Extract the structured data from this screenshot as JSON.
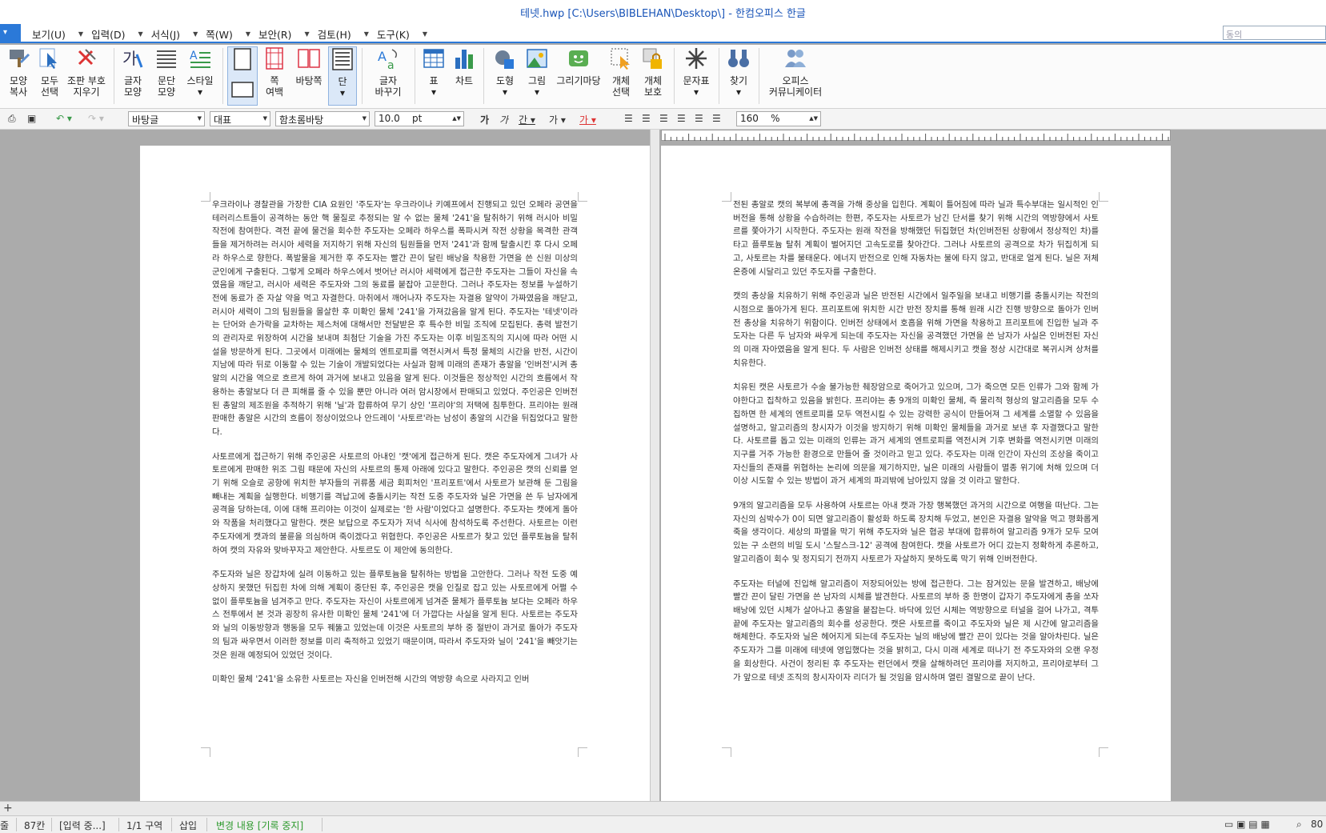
{
  "window": {
    "title": "테넷.hwp [C:\\Users\\BIBLEHAN\\Desktop\\] - 한컴오피스 한글"
  },
  "menu": {
    "items": [
      "보기(U)",
      "입력(D)",
      "서식(J)",
      "쪽(W)",
      "보안(R)",
      "검토(H)",
      "도구(K)"
    ],
    "search_placeholder": "동의"
  },
  "ribbon": {
    "shape_copy": [
      "모양",
      "복사"
    ],
    "select_all": [
      "모두",
      "선택"
    ],
    "clear_format": [
      "조판 부호",
      "지우기"
    ],
    "char_shape": [
      "글자",
      "모양"
    ],
    "para_shape": [
      "문단",
      "모양"
    ],
    "style": "스타일",
    "page_margin": [
      "쪽",
      "여백"
    ],
    "background_page": "바탕쪽",
    "columns": "단",
    "replace_chars": [
      "글자",
      "바꾸기"
    ],
    "table": "표",
    "chart": "차트",
    "shape": "도형",
    "picture": "그림",
    "drawing_market": "그리기마당",
    "object_select": [
      "개체",
      "선택"
    ],
    "object_protect": [
      "개체",
      "보호"
    ],
    "symbols": "문자표",
    "find": "찾기",
    "office_comm": [
      "오피스",
      "커뮤니케이터"
    ]
  },
  "format": {
    "style_combo": "바탕글",
    "lang_combo": "대표",
    "font_combo": "함초롬바탕",
    "size_value": "10.0",
    "size_unit": "pt",
    "zoom_value": "160",
    "zoom_unit": "%"
  },
  "left_page": {
    "paragraphs": [
      "우크라이나 경찰관을 가장한 CIA 요원인 '주도자'는 우크라이나 키예프에서 진행되고 있던 오페라 공연을 테러리스트들이 공격하는 동안 핵 물질로 추정되는 알 수 없는 물체 '241'을 탈취하기 위해 러시아 비밀 작전에 참여한다. 격전 끝에 물건을 회수한 주도자는 오페라 하우스를 폭파시켜 작전 상황을 목격한 관객들을 제거하려는 러시아 세력을 저지하기 위해 자신의 팀원들을 먼저 '241'과 함께 탈출시킨 후 다시 오페라 하우스로 향한다. 폭발물을 제거한 후 주도자는 빨간 끈이 달린 배낭을 착용한 가면을 쓴 신원 미상의 군인에게 구출된다. 그렇게 오페라 하우스에서 벗어난 러시아 세력에게 접근한 주도자는 그들이 자신을 속였음을 깨닫고, 러시아 세력은 주도자와 그의 동료를 붙잡아 고문한다. 그러나 주도자는 정보를 누설하기 전에 동료가 준 자살 약을 먹고 자결한다. 마취에서 깨어나자 주도자는 자결용 알약이 가짜였음을 깨닫고, 러시아 세력이 그의 팀원들을 몰살한 후 미확인 물체 '241'을 가져갔음을 알게 된다. 주도자는 '테넷'이라는 단어와 손가락을 교차하는 제스처에 대해서만 전달받은 후 특수한 비밀 조직에 모집된다. 총력 발전기의 관리자로 위장하여 시간을 보내며 최첨단 기술을 가진 주도자는 이후 비밀조직의 지시에 따라 어떤 시설을 방문하게 된다. 그곳에서 미래에는 물체의 엔트로피를 역전시켜서 특정 물체의 시간을 반전, 시간이 지남에 따라 뒤로 이동할 수 있는 기술이 개발되었다는 사실과 함께 미래의 존재가 총알을 '인버전'시켜 총알의 시간을 역으로 흐르게 하여 과거에 보내고 있음을 알게 된다. 이것들은 정상적인 시간의 흐름에서 작용하는 총알보다 더 큰 피해를 줄 수 있을 뿐만 아니라 여러 암시장에서 판매되고 있었다. 주인공은 인버전된 총알의 제조원을 추적하기 위해 '닐'과 합류하여 무기 상인 '프리야'의 저택에 침투한다. 프리야는 원래 판매한 총알은 시간의 흐름이 정상이었으나 안드레이 '사토르'라는 남성이 총알의 시간을 뒤집었다고 말한다.",
      "사토르에게 접근하기 위해 주인공은 사토르의 아내인 '캣'에게 접근하게 된다. 캣은 주도자에게 그녀가 사토르에게 판매한 위조 그림 때문에 자신의 사토르의 통제 아래에 있다고 말한다. 주인공은 캣의 신뢰를 얻기 위해 오슬로 공항에 위치한 부자들의 귀류품 세금 회피처인 '프리포트'에서 사토르가 보관해 둔 그림을 빼내는 계획을 실행한다. 비행기를 격납고에 충돌시키는 작전 도중 주도자와 닐은 가면을 쓴 두 남자에게 공격을 당하는데, 이에 대해 프리야는 이것이 실제로는 '한 사람'이었다고 설명한다. 주도자는 캣에게 돌아와 작품을 처리했다고 말한다. 캣은 보답으로 주도자가 저녁 식사에 참석하도록 주선한다. 사토르는 이런 주도자에게 캣과의 불륜을 의심하며 죽이겠다고 위협한다. 주인공은 사토르가 찾고 있던 플루토늄을 탈취하여 캣의 자유와 맞바꾸자고 제안한다. 사토르도 이 제안에 동의한다.",
      "주도자와 닐은 장갑차에 실려 이동하고 있는 플루토늄을 탈취하는 방법을 고안한다. 그러나 작전 도중 예상하지 못했던 뒤집힌 차에 의해 계획이 중단된 후, 주인공은 캣을 인질로 잡고 있는 사토르에게 어쩔 수 없이 플루토늄을 넘겨주고 만다. 주도자는 자신이 사토르에게 넘겨준 물체가 플루토늄 보다는 오페라 하우스 전투에서 본 것과 굉장히 유사한 미확인 물체 '241'에 더 가깝다는 사실을 알게 된다. 사토르는 주도자와 닐의 이동방향과 행동을 모두 꿰뚫고 있었는데 이것은 사토르의 부하 중 절반이 과거로 돌아가 주도자의 팀과 싸우면서 이러한 정보를 미리 축적하고 있었기 때문이며, 따라서 주도자와 닐이 '241'을 빼앗기는 것은 원래 예정되어 있었던 것이다.",
      "미확인 물체 '241'을 소유한 사토르는 자신을 인버전해 시간의 역방향 속으로 사라지고 인버"
    ]
  },
  "right_page": {
    "paragraphs": [
      "전된 총알로 캣의 복부에 총격을 가해 중상을 입힌다. 계획이 틀어짐에 따라 닐과 특수부대는 일시적인 인버전을 통해 상황을 수습하려는 한편, 주도자는 사토르가 남긴 단서를 찾기 위해 시간의 역방향에서 사토르를 쫓아가기 시작한다. 주도자는 원래 작전을 방해했던 뒤집혔던 차(인버전된 상황에서 정상적인 차)를 타고 플루토늄 탈취 계획이 벌어지던 고속도로를 찾아간다. 그러나 사토르의 공격으로 차가 뒤집히게 되고, 사토르는 차를 불태운다. 에너지 반전으로 인해 자동차는 불에 타지 않고, 반대로 얼게 된다. 닐은 저체온증에 시달리고 있던 주도자를 구출한다.",
      "캣의 총상을 치유하기 위해 주인공과 닐은 반전된 시간에서 일주일을 보내고 비행기를 충돌시키는 작전의 시점으로 돌아가게 된다. 프리포트에 위치한 시간 반전 장치를 통해 원래 시간 진행 방향으로 돌아가 인버전 총상을 치유하기 위함이다. 인버전 상태에서 호흡을 위해 가면을 착용하고 프리포트에 진입한 닐과 주도자는 다른 두 남자와 싸우게 되는데 주도자는 자신을 공격했던 가면을 쓴 남자가 사실은 인버전된 자신의 미래 자아였음을 알게 된다. 두 사람은 인버전 상태를 해제시키고 캣을 정상 시간대로 복귀시켜 상처를 치유한다.",
      "치유된 캣은 사토르가 수술 불가능한 췌장암으로 죽어가고 있으며, 그가 죽으면 모든 인류가 그와 함께 가야한다고 집착하고 있음을 밝힌다. 프리야는 총 9개의 미확인 물체, 즉 물리적 형상의 알고리즘을 모두 수집하면 한 세계의 엔트로피를 모두 역전시킬 수 있는 강력한 공식이 만들어져 그 세계를 소멸할 수 있음을 설명하고, 알고리즘의 창시자가 이것을 방지하기 위해 미확인 물체들을 과거로 보낸 후 자결했다고 말한다. 사토르를 돕고 있는 미래의 인류는 과거 세계의 엔트로피를 역전시켜 기후 변화를 역전시키면 미래의 지구를 거주 가능한 환경으로 만들어 줄 것이라고 믿고 있다. 주도자는 미래 인간이 자신의 조상을 죽이고 자신들의 존재를 위협하는 논리에 의문을 제기하지만, 닐은 미래의 사람들이 멸종 위기에 처해 있으며 더이상 시도할 수 있는 방법이 과거 세계의 파괴밖에 남아있지 않을 것 이라고 말한다.",
      "9개의 알고리즘을 모두 사용하여 사토르는 아내 캣과 가장 행복했던 과거의 시간으로 여행을 떠난다. 그는 자신의 심박수가 0이 되면 알고리즘이 활성화 하도록 장치해 두었고, 본인은 자결용 알약을 먹고 평화롭게 죽을 생각이다. 세상의 파멸을 막기 위해 주도자와 닐은 협공 부대에 합류하여 알고리즘 9개가 모두 모여있는 구 소련의 비밀 도시 '스탈스크-12' 공격에 참여한다. 캣을 사토르가 어디 갔는지 정확하게 추론하고, 알고리즘이 회수 및 정지되기 전까지 사토르가 자살하지 못하도록 막기 위해 인버전한다.",
      "주도자는 터널에 진입해 알고리즘이 저장되어있는 방에 접근한다. 그는 잠겨있는 문을 발견하고, 배낭에 빨간 끈이 달린 가면을 쓴 남자의 시체를 발견한다. 사토르의 부하 중 한명이 갑자기 주도자에게 총을 쏘자 배낭에 있던 시체가 살아나고 총알을 붙잡는다. 바닥에 있던 시체는 역방향으로 터널을 걸어 나가고, 격투 끝에 주도자는 알고리즘의 회수를 성공한다. 캣은 사토르를 죽이고 주도자와 닐은 제 시간에 알고리즘을 해체한다. 주도자와 닐은 헤어지게 되는데 주도자는 닐의 배낭에 빨간 끈이 있다는 것을 알아차린다. 닐은 주도자가 그를 미래에 테넷에 영입했다는 것을 밝히고, 다시 미래 세계로 떠나기 전 주도자와의 오랜 우정을 회상한다. 사건이 정리된 후 주도자는 런던에서 캣을 살해하려던 프리야를 저지하고, 프리야로부터 그가 앞으로 테넷 조직의 창시자이자 리더가 될 것임을 암시하며 열린 결말으로 끝이 난다."
    ]
  },
  "status": {
    "page_prefix": "줄",
    "line": "87칸",
    "mode": "[입력 중...]",
    "section": "1/1 구역",
    "insert": "삽입",
    "track": "변경 내용 [기록 중지]",
    "zoom": "80"
  }
}
